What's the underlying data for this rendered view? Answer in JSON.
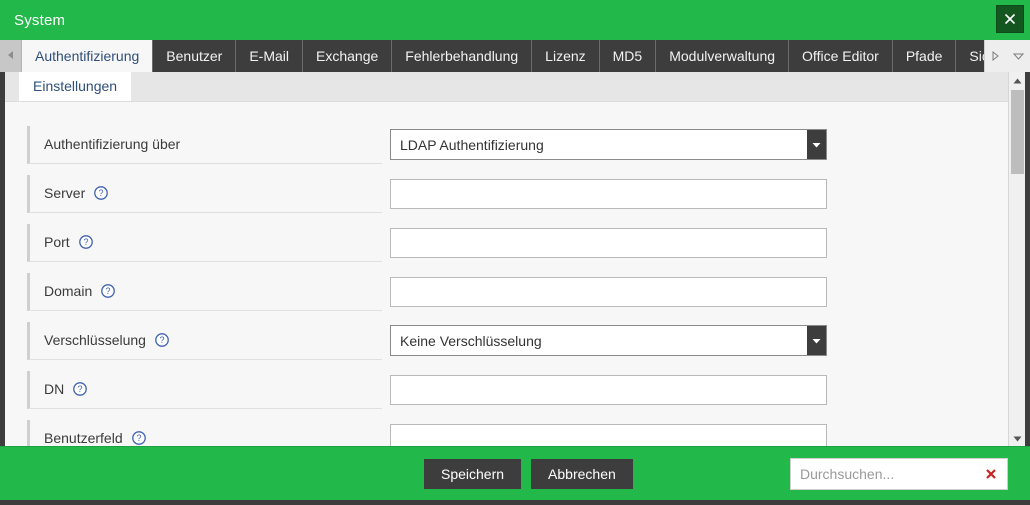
{
  "window": {
    "title": "System",
    "close_label": "×",
    "close_icon": "close-icon"
  },
  "tabbar": {
    "scroll_left_icon": "chevron-left-icon",
    "scroll_right_icon": "chevron-right-icon",
    "dropdown_icon": "chevron-down-icon",
    "tabs": [
      {
        "label": "Authentifizierung",
        "active": true
      },
      {
        "label": "Benutzer",
        "active": false
      },
      {
        "label": "E-Mail",
        "active": false
      },
      {
        "label": "Exchange",
        "active": false
      },
      {
        "label": "Fehlerbehandlung",
        "active": false
      },
      {
        "label": "Lizenz",
        "active": false
      },
      {
        "label": "MD5",
        "active": false
      },
      {
        "label": "Modulverwaltung",
        "active": false
      },
      {
        "label": "Office Editor",
        "active": false
      },
      {
        "label": "Pfade",
        "active": false
      },
      {
        "label": "Sicherheit",
        "active": false
      }
    ]
  },
  "subtabs": [
    {
      "label": "Einstellungen",
      "active": true
    }
  ],
  "form": {
    "rows": [
      {
        "label": "Authentifizierung über",
        "help": false,
        "control": "select",
        "value": "LDAP Authentifizierung"
      },
      {
        "label": "Server",
        "help": true,
        "control": "text",
        "value": "",
        "placeholder": ""
      },
      {
        "label": "Port",
        "help": true,
        "control": "text",
        "value": "",
        "placeholder": ""
      },
      {
        "label": "Domain",
        "help": true,
        "control": "text",
        "value": "",
        "placeholder": ""
      },
      {
        "label": "Verschlüsselung",
        "help": true,
        "control": "select",
        "value": "Keine Verschlüsselung"
      },
      {
        "label": "DN",
        "help": true,
        "control": "text",
        "value": "",
        "placeholder": ""
      },
      {
        "label": "Benutzerfeld",
        "help": true,
        "control": "text",
        "value": "",
        "placeholder": ""
      }
    ]
  },
  "scrollbar": {
    "up_icon": "triangle-up-icon",
    "down_icon": "triangle-down-icon"
  },
  "footer": {
    "save_label": "Speichern",
    "cancel_label": "Abbrechen",
    "search_placeholder": "Durchsuchen...",
    "search_value": "",
    "clear_icon": "clear-x-icon"
  },
  "colors": {
    "brand_green": "#22b84a",
    "dark_gray": "#3d3d3d",
    "close_green": "#14561f",
    "clear_red": "#cc2222",
    "help_blue": "#3f62b0",
    "tab_active_text": "#2f4f7a"
  }
}
